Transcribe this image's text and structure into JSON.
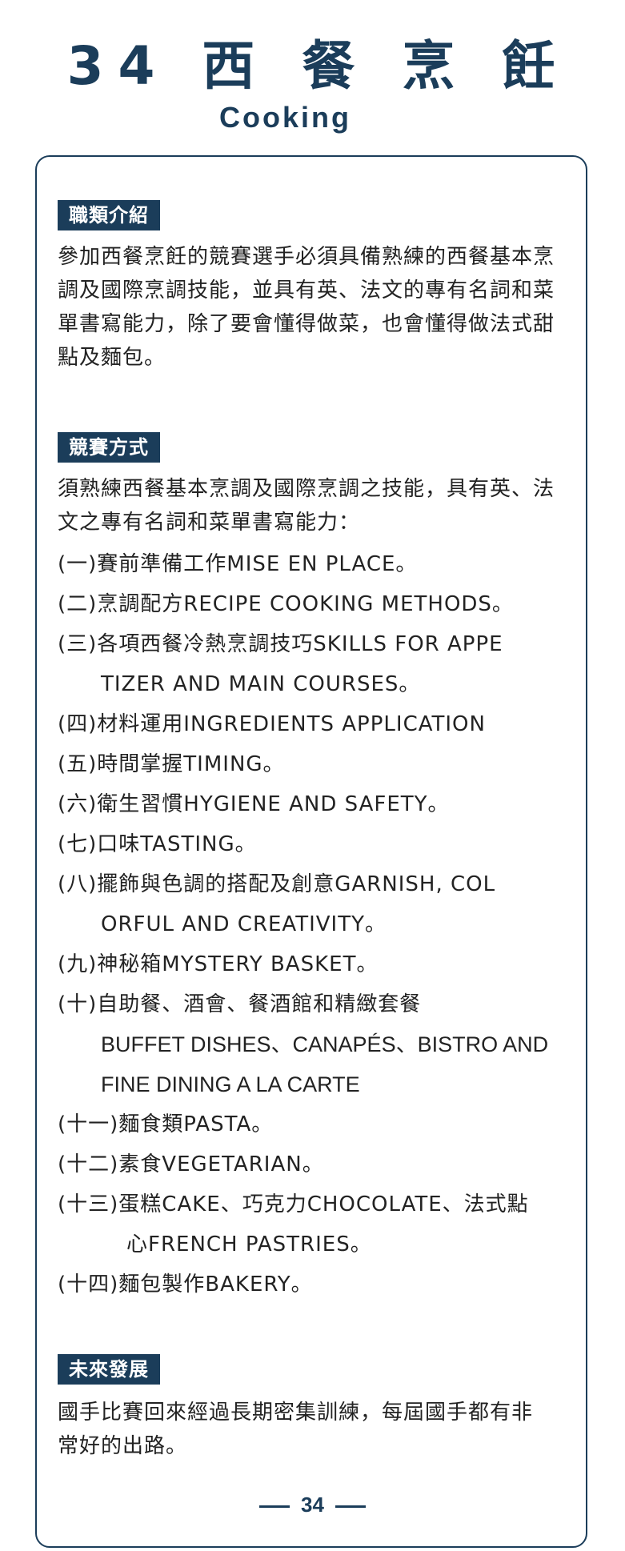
{
  "header": {
    "title": "34 西 餐 烹 飪",
    "subtitle": "Cooking"
  },
  "sections": {
    "intro": {
      "tag": "職類介紹",
      "text": "參加西餐烹飪的競賽選手必須具備熟練的西餐基本烹調及國際烹調技能，並具有英、法文的專有名詞和菜單書寫能力，除了要會懂得做菜，也會懂得做法式甜點及麵包。"
    },
    "method": {
      "tag": "競賽方式",
      "text": "須熟練西餐基本烹調及國際烹調之技能，具有英、法文之專有名詞和菜單書寫能力：",
      "items": [
        {
          "num": "(一)",
          "line1": "賽前準備工作MISE EN PLACE。",
          "line2": ""
        },
        {
          "num": "(二)",
          "line1": "烹調配方RECIPE COOKING METHODS。",
          "line2": ""
        },
        {
          "num": "(三)",
          "line1": "各項西餐冷熱烹調技巧SKILLS FOR APPE",
          "line2": "TIZER AND MAIN COURSES。"
        },
        {
          "num": "(四)",
          "line1": "材料運用INGREDIENTS APPLICATION",
          "line2": ""
        },
        {
          "num": "(五)",
          "line1": "時間掌握TIMING。",
          "line2": ""
        },
        {
          "num": "(六)",
          "line1": "衛生習慣HYGIENE AND SAFETY。",
          "line2": ""
        },
        {
          "num": "(七)",
          "line1": "口味TASTING。",
          "line2": ""
        },
        {
          "num": "(八)",
          "line1": "擺飾與色調的搭配及創意GARNISH, COL",
          "line2": "ORFUL AND CREATIVITY。"
        },
        {
          "num": "(九)",
          "line1": "神秘箱MYSTERY BASKET。",
          "line2": ""
        },
        {
          "num": "(十)",
          "line1": "自助餐、酒會、餐酒館和精緻套餐",
          "line2": "BUFFET DISHES、CANAPÉS、BISTRO AND",
          "line3": "FINE DINING A LA CARTE"
        },
        {
          "num": "(十一)",
          "line1": "麵食類PASTA。",
          "line2": ""
        },
        {
          "num": "(十二)",
          "line1": "素食VEGETARIAN。",
          "line2": ""
        },
        {
          "num": "(十三)",
          "line1": "蛋糕CAKE、巧克力CHOCOLATE、法式點",
          "line2": "心FRENCH PASTRIES。"
        },
        {
          "num": "(十四)",
          "line1": "麵包製作BAKERY。",
          "line2": ""
        }
      ]
    },
    "future": {
      "tag": "未來發展",
      "text": "國手比賽回來經過長期密集訓練，每屆國手都有非常好的出路。"
    }
  },
  "footer": {
    "page_number": "34"
  }
}
